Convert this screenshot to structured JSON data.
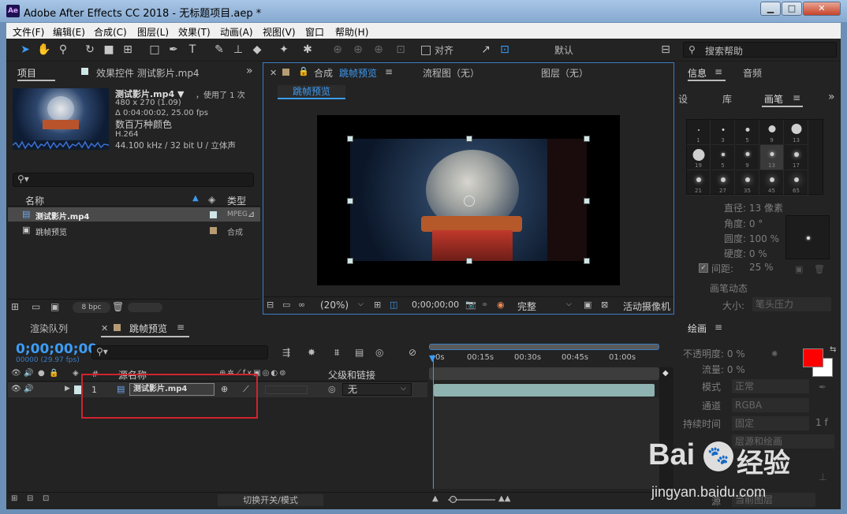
{
  "window": {
    "title": "Adobe After Effects CC 2018 - 无标题项目.aep *",
    "logo": "Ae",
    "min": "▁",
    "max": "□",
    "close": "✕"
  },
  "menu": [
    "文件(F)",
    "编辑(E)",
    "合成(C)",
    "图层(L)",
    "效果(T)",
    "动画(A)",
    "视图(V)",
    "窗口",
    "帮助(H)"
  ],
  "toolbar": {
    "snap_label": "对齐",
    "workspace": "默认",
    "search_placeholder": "搜索帮助"
  },
  "project_panel": {
    "tab": "项目",
    "effects_tab": "效果控件 测试影片.mp4",
    "file_name": "测试影片.mp4 ▼",
    "used": "，使用了 1 次",
    "resolution": "480 x 270 (1.09)",
    "duration": "Δ 0:04:00:02, 25.00 fps",
    "colors": "数百万种颜色",
    "codec": "H.264",
    "audio": "44.100 kHz / 32 bit U / 立体声",
    "col_name": "名称",
    "col_type": "类型",
    "items": [
      {
        "name": "测试影片.mp4",
        "type": "MPEG",
        "color": "#cfe6e6"
      },
      {
        "name": "跳帧预览",
        "type": "合成",
        "color": "#b79b74"
      }
    ],
    "bpc": "8 bpc"
  },
  "comp_panel": {
    "tab_prefix": "合成",
    "tab_name": "跳帧预览",
    "flowchart": "流程图（无）",
    "layer": "图层（无）",
    "sub_tab": "跳帧预览",
    "zoom": "(20%)",
    "timecode": "0;00;00;00",
    "quality": "完整",
    "camera": "活动摄像机"
  },
  "right_panel": {
    "tab_info": "信息",
    "tab_audio": "音频",
    "tab_presets": "设",
    "tab_library": "库",
    "tab_brushes": "画笔",
    "brush_sizes": [
      "1",
      "3",
      "5",
      "9",
      "13",
      "19",
      "5",
      "9",
      "13",
      "17",
      "21",
      "27",
      "35",
      "45",
      "65"
    ],
    "diameter": "直径: 13 像素",
    "angle": "角度: 0 °",
    "roundness": "圆度: 100 %",
    "hardness": "硬度: 0 %",
    "spacing_label": "间距:",
    "spacing_value": "25 %",
    "dynamics": "画笔动态",
    "size_label": "大小:",
    "size_value": "笔头压力",
    "paint_tab": "绘画",
    "opacity": "不透明度: 0 %",
    "flow": "流量: 0 %",
    "mode_label": "模式",
    "mode_value": "正常",
    "channel_label": "通道",
    "channel_value": "RGBA",
    "duration_label": "持续时间",
    "duration_value": "固定",
    "frames": "1 f",
    "erase_label": "层源和绘画",
    "source_label": "源",
    "source_value": "当前图层",
    "fg_color": "#ff0000",
    "bg_color": "#ffffff"
  },
  "timeline": {
    "render_tab": "渲染队列",
    "comp_tab": "跳帧预览",
    "timecode": "0;00;00;00",
    "frames_info": "00000 (29.97 fps)",
    "col_number": "#",
    "col_source": "源名称",
    "col_parent": "父级和链接",
    "layer_number": "1",
    "layer_name": "测试影片.mp4",
    "parent_value": "无",
    "ruler": [
      "0s",
      "00:15s",
      "00:30s",
      "00:45s",
      "01:00s"
    ],
    "switch_mode": "切换开关/模式"
  },
  "watermark": {
    "brand": "Bai",
    "brand2": "经验",
    "url": "jingyan.baidu.com"
  }
}
